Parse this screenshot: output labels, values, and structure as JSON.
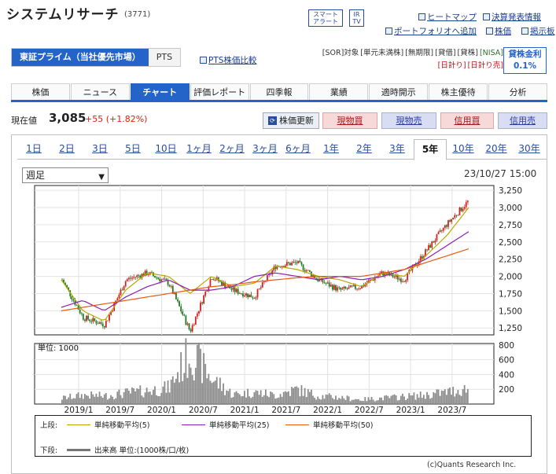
{
  "header": {
    "company_name": "システムリサーチ",
    "code": "(3771)",
    "badge_smart_1": "スマート",
    "badge_smart_2": "アラート",
    "badge_ir_1": "IR",
    "badge_ir_2": "TV",
    "link_heatmap": "ヒートマップ",
    "link_earnings": "決算発表情報",
    "link_portfolio": "ポートフォリオへ追加",
    "link_price": "株価",
    "link_board": "掲示板"
  },
  "market": {
    "selected": "東証プライム（当社優先市場）",
    "other": "PTS",
    "pts_compare": "PTS株価比較"
  },
  "tags": [
    "[SOR]対象",
    "[単元未満株]",
    "[無期限]",
    "[貸借]",
    "[貸株]",
    "[NISA]",
    "[日計り]",
    "[日計り売]"
  ],
  "lending": {
    "label": "貸株金利",
    "rate": "0.1%"
  },
  "nav_tabs": [
    "株価",
    "ニュース",
    "チャート",
    "評価レポート",
    "四季報",
    "業績",
    "適時開示",
    "株主優待",
    "分析"
  ],
  "active_tab": "チャート",
  "quote": {
    "label": "現在値",
    "price": "3,085",
    "change": "+55 (+1.82%)"
  },
  "actions": {
    "update": "株価更新",
    "spot_buy": "現物買",
    "spot_sell": "現物売",
    "margin_buy": "信用買",
    "margin_sell": "信用売"
  },
  "periods": [
    "1日",
    "2日",
    "3日",
    "5日",
    "10日",
    "1ヶ月",
    "2ヶ月",
    "3ヶ月",
    "6ヶ月",
    "1年",
    "2年",
    "3年",
    "5年",
    "10年",
    "20年",
    "30年"
  ],
  "active_period": "5年",
  "interval_select": "週足",
  "chart_timestamp": "23/10/27 15:00",
  "legend": {
    "upper_label": "上段:",
    "ma5": "単純移動平均(5)",
    "ma25": "単純移動平均(25)",
    "ma50": "単純移動平均(50)",
    "lower_label": "下段:",
    "volume": "出来高 単位:(1000株/口/枚)"
  },
  "copyright": "(c)Quants Research Inc.",
  "colors": {
    "accent": "#2463c7",
    "up": "#d21f1f",
    "ma5": "#b8a800",
    "ma25": "#8a1fb5",
    "ma50": "#e85a14",
    "volume": "#888888"
  },
  "chart_data": [
    {
      "type": "candlestick",
      "x_ticks": [
        "2019/1",
        "2019/7",
        "2020/1",
        "2020/7",
        "2021/1",
        "2021/7",
        "2022/1",
        "2022/7",
        "2023/1",
        "2023/7"
      ],
      "y_ticks": [
        "3,250",
        "3,000",
        "2,750",
        "2,500",
        "2,250",
        "2,000",
        "1,750",
        "1,500",
        "1,250"
      ],
      "ylim": [
        1150,
        3320
      ],
      "series": [
        {
          "name": "単純移動平均(5)",
          "values": [
            1950,
            1500,
            1350,
            1800,
            2050,
            2000,
            1750,
            2000,
            1850,
            1900,
            2150,
            2100,
            2000,
            1950,
            1850,
            2050,
            2000,
            2300,
            2600,
            3000
          ]
        },
        {
          "name": "単純移動平均(25)",
          "values": [
            1550,
            1650,
            1500,
            1700,
            1850,
            1950,
            1800,
            1800,
            1850,
            2000,
            2050,
            2000,
            1950,
            2000,
            1950,
            2000,
            2100,
            2250,
            2450,
            2650
          ]
        },
        {
          "name": "単純移動平均(50)",
          "values": [
            1500,
            1550,
            1600,
            1650,
            1700,
            1750,
            1800,
            1850,
            1880,
            1920,
            1950,
            1980,
            2000,
            2000,
            2000,
            2050,
            2100,
            2200,
            2300,
            2400
          ]
        }
      ],
      "close": [
        1950,
        1400,
        1300,
        1950,
        2050,
        1900,
        1200,
        2000,
        1800,
        1700,
        2150,
        2200,
        1950,
        1800,
        1850,
        2050,
        1950,
        2350,
        2750,
        3085
      ]
    },
    {
      "type": "bar",
      "title": "単位: 1000",
      "y_ticks": [
        "800",
        "600",
        "400",
        "200"
      ],
      "ylim": [
        0,
        820
      ],
      "values": [
        80,
        120,
        110,
        150,
        180,
        220,
        700,
        350,
        130,
        160,
        120,
        200,
        110,
        90,
        60,
        80,
        100,
        120,
        160,
        210
      ]
    }
  ]
}
